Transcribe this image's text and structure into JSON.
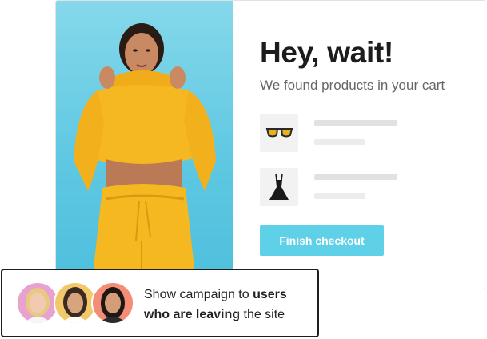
{
  "popup": {
    "title": "Hey, wait!",
    "subtitle": "We found products in your cart",
    "products": [
      {
        "icon": "sunglasses-icon"
      },
      {
        "icon": "dress-icon"
      }
    ],
    "cta_label": "Finish checkout",
    "colors": {
      "accent": "#5ed0e8",
      "hero_background": "#5fc8e2",
      "hoodie": "#f5b820",
      "placeholder_line": "#e1e1e1"
    }
  },
  "banner": {
    "text_part1": "Show campaign to ",
    "text_bold": "users who are leaving",
    "text_part2": " the site",
    "avatars": [
      "avatar-blonde",
      "avatar-dark-hair",
      "avatar-black-hair"
    ],
    "colors": {
      "border": "#1e1e1e"
    }
  }
}
